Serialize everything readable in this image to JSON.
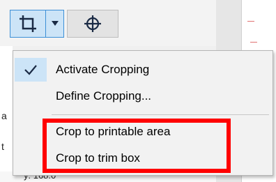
{
  "toolbar": {
    "crop_icon": "crop-icon",
    "dropdown_icon": "caret-down-icon",
    "target_icon": "crosshair-target-icon"
  },
  "menu": {
    "items": [
      {
        "label": "Activate Cropping",
        "checked": true
      },
      {
        "label": "Define Cropping..."
      },
      {
        "label": "Crop to printable area"
      },
      {
        "label": "Crop to trim box"
      }
    ],
    "highlight_color": "#ff0000"
  },
  "background": {
    "peek_texts": [
      "a",
      "t",
      "y: 168.0"
    ]
  }
}
